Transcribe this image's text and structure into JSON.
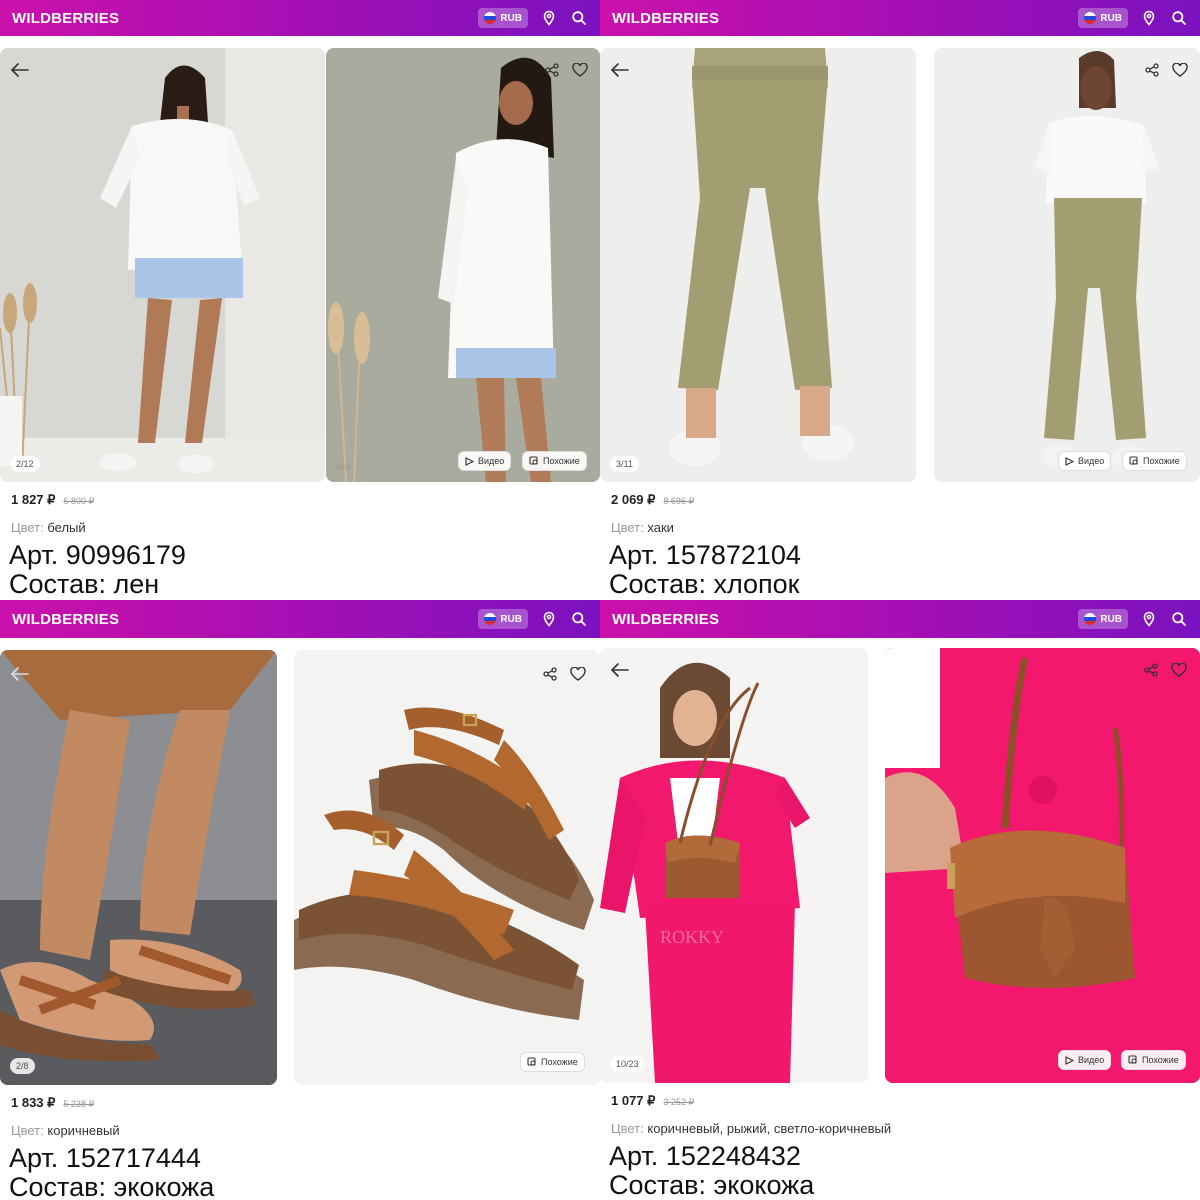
{
  "app": {
    "logo": "WILDBERRIES",
    "currency": "RUB",
    "brand_gradient": [
      "#cb11ab",
      "#7a12bf"
    ]
  },
  "products": [
    {
      "counter": "2/12",
      "video_label": "Видео",
      "similar_label": "Похожие",
      "watermark": "WB",
      "price": "1 827 ₽",
      "old_price": "6 800 ₽",
      "color_label": "Цвет:",
      "color_value": "белый",
      "article": "Арт. 90996179",
      "composition": "Состав: лен"
    },
    {
      "counter": "3/11",
      "video_label": "Видео",
      "similar_label": "Похожие",
      "price": "2 069 ₽",
      "old_price": "8 696 ₽",
      "color_label": "Цвет:",
      "color_value": "хаки",
      "article": "Арт. 157872104",
      "composition": "Состав: хлопок"
    },
    {
      "counter": "2/8",
      "similar_label": "Похожие",
      "price": "1 833 ₽",
      "old_price": "5 238 ₽",
      "color_label": "Цвет:",
      "color_value": "коричневый",
      "article": "Арт. 152717444",
      "composition": "Состав: экокожа"
    },
    {
      "counter": "10/23",
      "video_label": "Видео",
      "similar_label": "Похожие",
      "watermark": "ROKKY",
      "price": "1 077 ₽",
      "old_price": "3 252 ₽",
      "color_label": "Цвет:",
      "color_value": "коричневый, рыжий, светло-коричневый",
      "article": "Арт. 152248432",
      "composition": "Состав: экокожа"
    }
  ]
}
